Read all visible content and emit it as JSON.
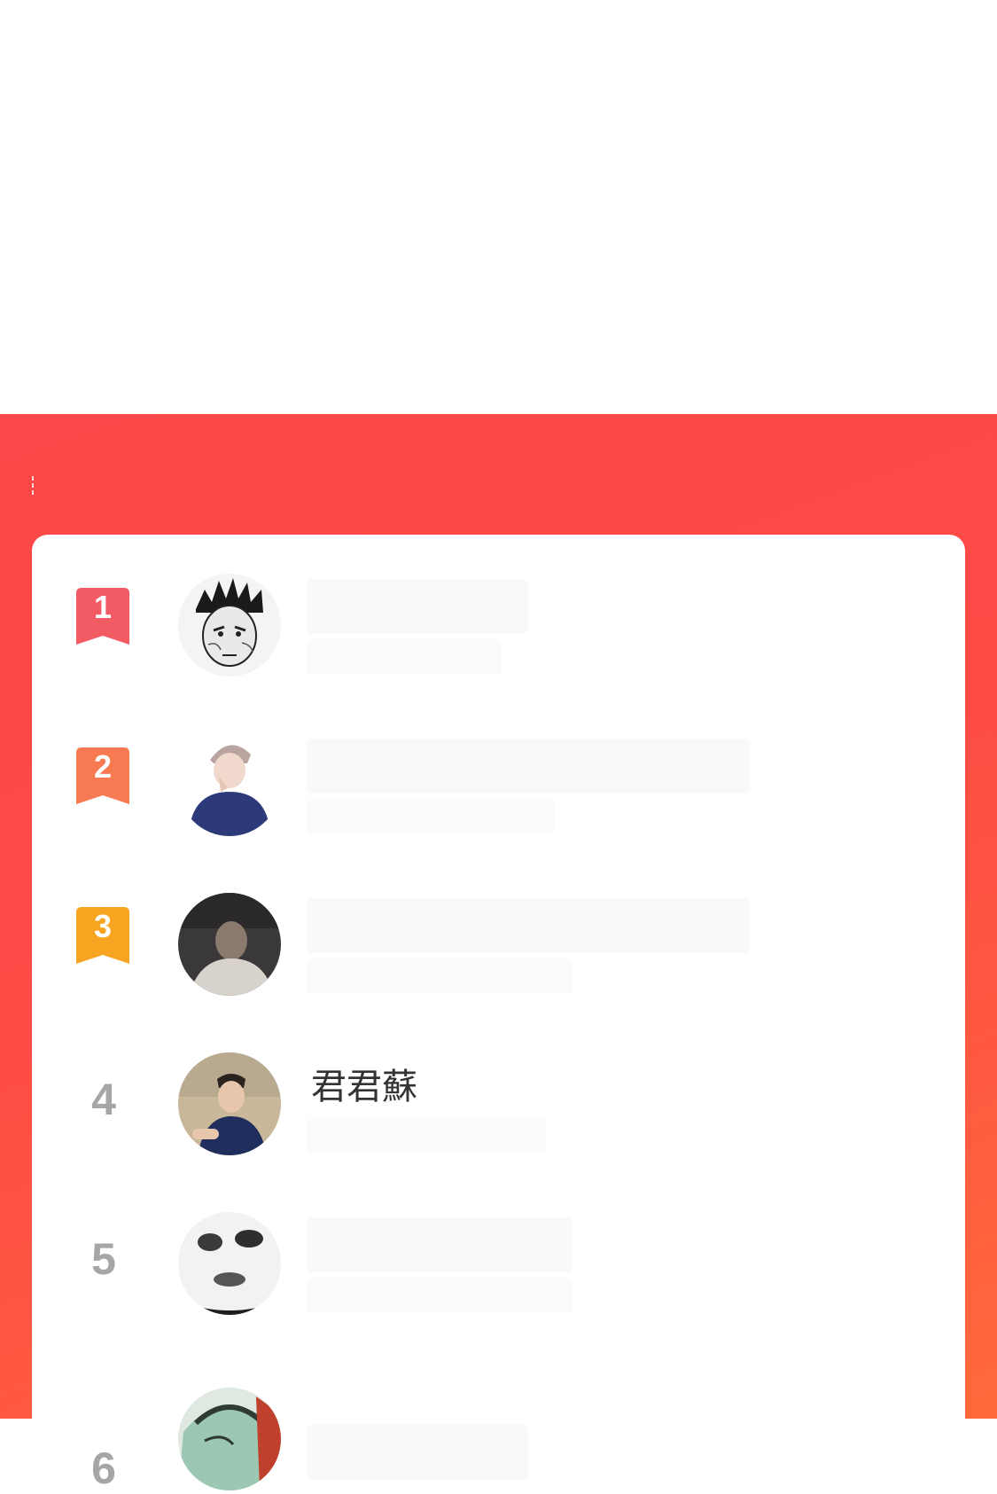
{
  "colors": {
    "panel_red": "#fd4b46",
    "badge_first": "#f25a64",
    "badge_second": "#f77a52",
    "badge_third": "#f7a421",
    "rank_gray": "#a6a6a6"
  },
  "ranking": {
    "rows": [
      {
        "rank": "1",
        "name": ""
      },
      {
        "rank": "2",
        "name": ""
      },
      {
        "rank": "3",
        "name": ""
      },
      {
        "rank": "4",
        "name": "君君蘇"
      },
      {
        "rank": "5",
        "name": ""
      },
      {
        "rank": "6",
        "name": ""
      }
    ]
  }
}
